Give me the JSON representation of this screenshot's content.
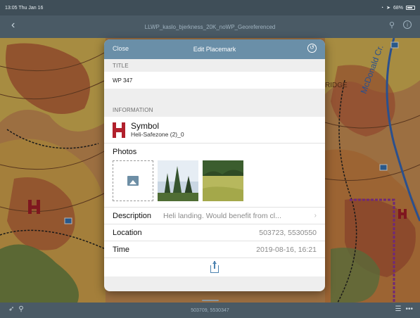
{
  "status_bar": {
    "time": "13:05",
    "date": "Thu Jan 16",
    "battery": "68%"
  },
  "nav": {
    "title": "LLWP_kaslo_bjerkness_20K_noWP_Georeferenced",
    "back_icon": "chevron-left-icon"
  },
  "map": {
    "label_creek": "McDonald Cr.",
    "label_ridge": "RIDGE"
  },
  "sheet": {
    "close": "Close",
    "title": "Edit Placemark",
    "title_section": "TITLE",
    "title_value": "WP 347",
    "info_section": "INFORMATION",
    "symbol_label": "Symbol",
    "symbol_value": "Heli-Safezone (2)_0",
    "photos_label": "Photos",
    "description_label": "Description",
    "description_value": "Heli landing. Would benefit from cl...",
    "location_label": "Location",
    "location_value": "503723, 5530550",
    "time_label": "Time",
    "time_value": "2019-08-16, 16:21"
  },
  "bottom_bar": {
    "coordinates": "503709, 5530347"
  },
  "colors": {
    "header": "#6a8fa8",
    "heli_red": "#b1202c",
    "accent": "#4d83b0"
  }
}
